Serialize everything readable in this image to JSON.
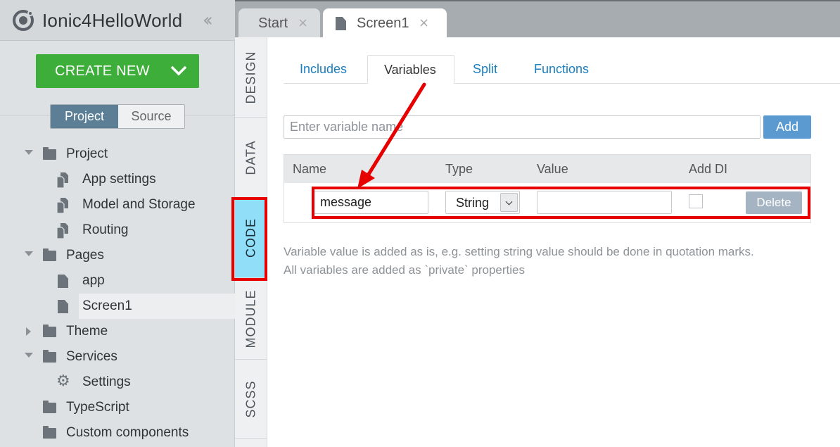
{
  "app": {
    "title": "Ionic4HelloWorld",
    "logo_icon": "ionic-logo-icon",
    "collapse_icon": "double-chevron-left-icon",
    "create_new_label": "CREATE NEW",
    "create_new_color": "#3eae3a"
  },
  "sidebar": {
    "segment": {
      "project_label": "Project",
      "source_label": "Source",
      "active": "Project",
      "active_color": "#5c7f96"
    },
    "tree": [
      {
        "label": "Project",
        "icon": "folder-icon",
        "expanded": true
      },
      {
        "label": "App settings",
        "icon": "settings-files-icon"
      },
      {
        "label": "Model and Storage",
        "icon": "settings-files-icon"
      },
      {
        "label": "Routing",
        "icon": "settings-files-icon"
      },
      {
        "label": "Pages",
        "icon": "folder-icon",
        "expanded": true
      },
      {
        "label": "app",
        "icon": "page-icon"
      },
      {
        "label": "Screen1",
        "icon": "page-icon",
        "selected": true
      },
      {
        "label": "Theme",
        "icon": "folder-icon",
        "expanded": false
      },
      {
        "label": "Services",
        "icon": "folder-icon",
        "expanded": true
      },
      {
        "label": "Settings",
        "icon": "gear-icon"
      },
      {
        "label": "TypeScript",
        "icon": "folder-icon"
      },
      {
        "label": "Custom components",
        "icon": "folder-icon"
      }
    ]
  },
  "file_tabs": [
    {
      "label": "Start",
      "active": false
    },
    {
      "label": "Screen1",
      "active": true,
      "icon": "page-icon"
    }
  ],
  "vertical_tabs": [
    {
      "label": "DESIGN"
    },
    {
      "label": "DATA"
    },
    {
      "label": "CODE",
      "active": true
    },
    {
      "label": "MODULE"
    },
    {
      "label": "SCSS"
    }
  ],
  "code_tabs": [
    {
      "label": "Includes"
    },
    {
      "label": "Variables",
      "active": true
    },
    {
      "label": "Split"
    },
    {
      "label": "Functions"
    }
  ],
  "variables": {
    "input_placeholder": "Enter variable name",
    "add_label": "Add",
    "columns": [
      "Name",
      "Type",
      "Value",
      "Add DI"
    ],
    "rows": [
      {
        "name": "message",
        "type": "String",
        "value": "",
        "add_di": false,
        "delete_label": "Delete"
      }
    ],
    "help_line1": "Variable value is added as is, e.g. setting string value should be done in quotation marks.",
    "help_line2": "All variables are added as `private` properties"
  },
  "colors": {
    "accent": "#1a7fc1",
    "annotation": "#e60000",
    "active_vtab": "#90def7"
  }
}
